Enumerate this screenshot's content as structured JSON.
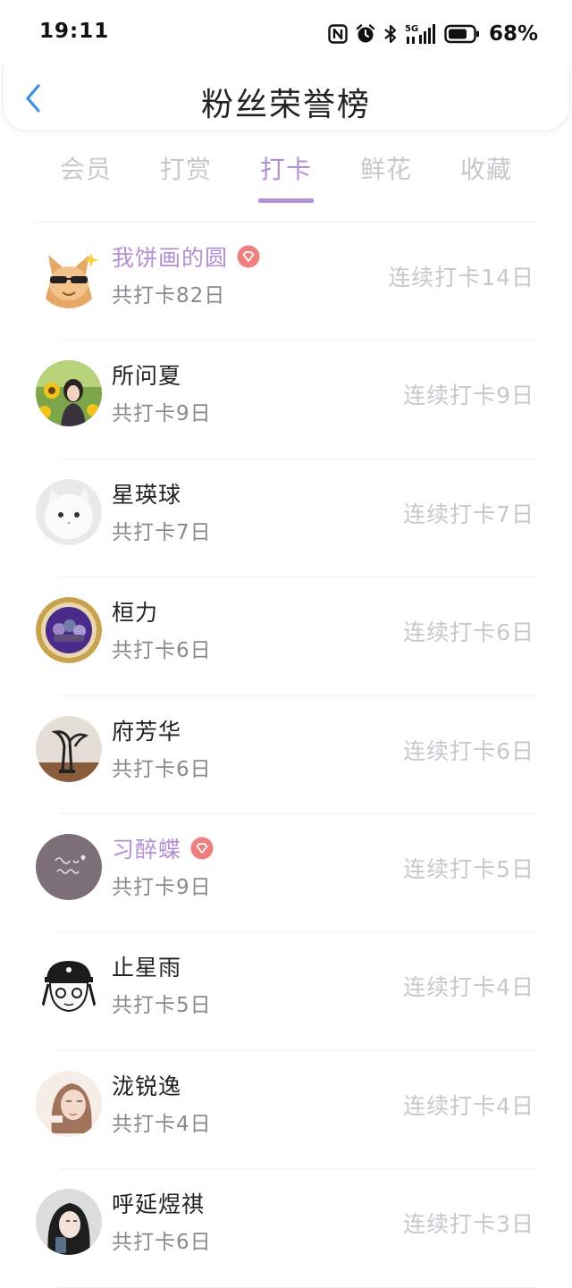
{
  "status_bar": {
    "time": "19:11",
    "battery_percent": "68%",
    "network_label": "5G",
    "icons": [
      "nfc-icon",
      "alarm-icon",
      "bluetooth-icon",
      "signal-5g-icon",
      "battery-icon"
    ]
  },
  "header": {
    "title": "粉丝荣誉榜",
    "back_icon": "chevron-left-icon"
  },
  "tabs": [
    {
      "label": "会员",
      "active": false
    },
    {
      "label": "打赏",
      "active": false
    },
    {
      "label": "打卡",
      "active": true
    },
    {
      "label": "鲜花",
      "active": false
    },
    {
      "label": "收藏",
      "active": false
    }
  ],
  "colors": {
    "accent": "#b48fd6",
    "vip_badge": "#ef7f7f",
    "muted_text": "#c8c8cc",
    "secondary_text": "#8a8a8e"
  },
  "list": [
    {
      "name": "我饼画的圆",
      "vip": true,
      "total": "共打卡82日",
      "streak": "连续打卡14日",
      "avatar": "cat-with-sunglasses"
    },
    {
      "name": "所问夏",
      "vip": false,
      "total": "共打卡9日",
      "streak": "连续打卡9日",
      "avatar": "girl-with-sunflowers"
    },
    {
      "name": "星瑛球",
      "vip": false,
      "total": "共打卡7日",
      "streak": "连续打卡7日",
      "avatar": "white-cat"
    },
    {
      "name": "桓力",
      "vip": false,
      "total": "共打卡6日",
      "streak": "连续打卡6日",
      "avatar": "purple-medallion"
    },
    {
      "name": "府芳华",
      "vip": false,
      "total": "共打卡6日",
      "streak": "连续打卡6日",
      "avatar": "crane-sculpture"
    },
    {
      "name": "习醉蝶",
      "vip": true,
      "total": "共打卡9日",
      "streak": "连续打卡5日",
      "avatar": "mauve-handwriting"
    },
    {
      "name": "止星雨",
      "vip": false,
      "total": "共打卡5日",
      "streak": "连续打卡4日",
      "avatar": "anime-boy-cap"
    },
    {
      "name": "泷锐逸",
      "vip": false,
      "total": "共打卡4日",
      "streak": "连续打卡4日",
      "avatar": "girl-portrait"
    },
    {
      "name": "呼延煜祺",
      "vip": false,
      "total": "共打卡6日",
      "streak": "连续打卡3日",
      "avatar": "girl-with-phone"
    }
  ]
}
